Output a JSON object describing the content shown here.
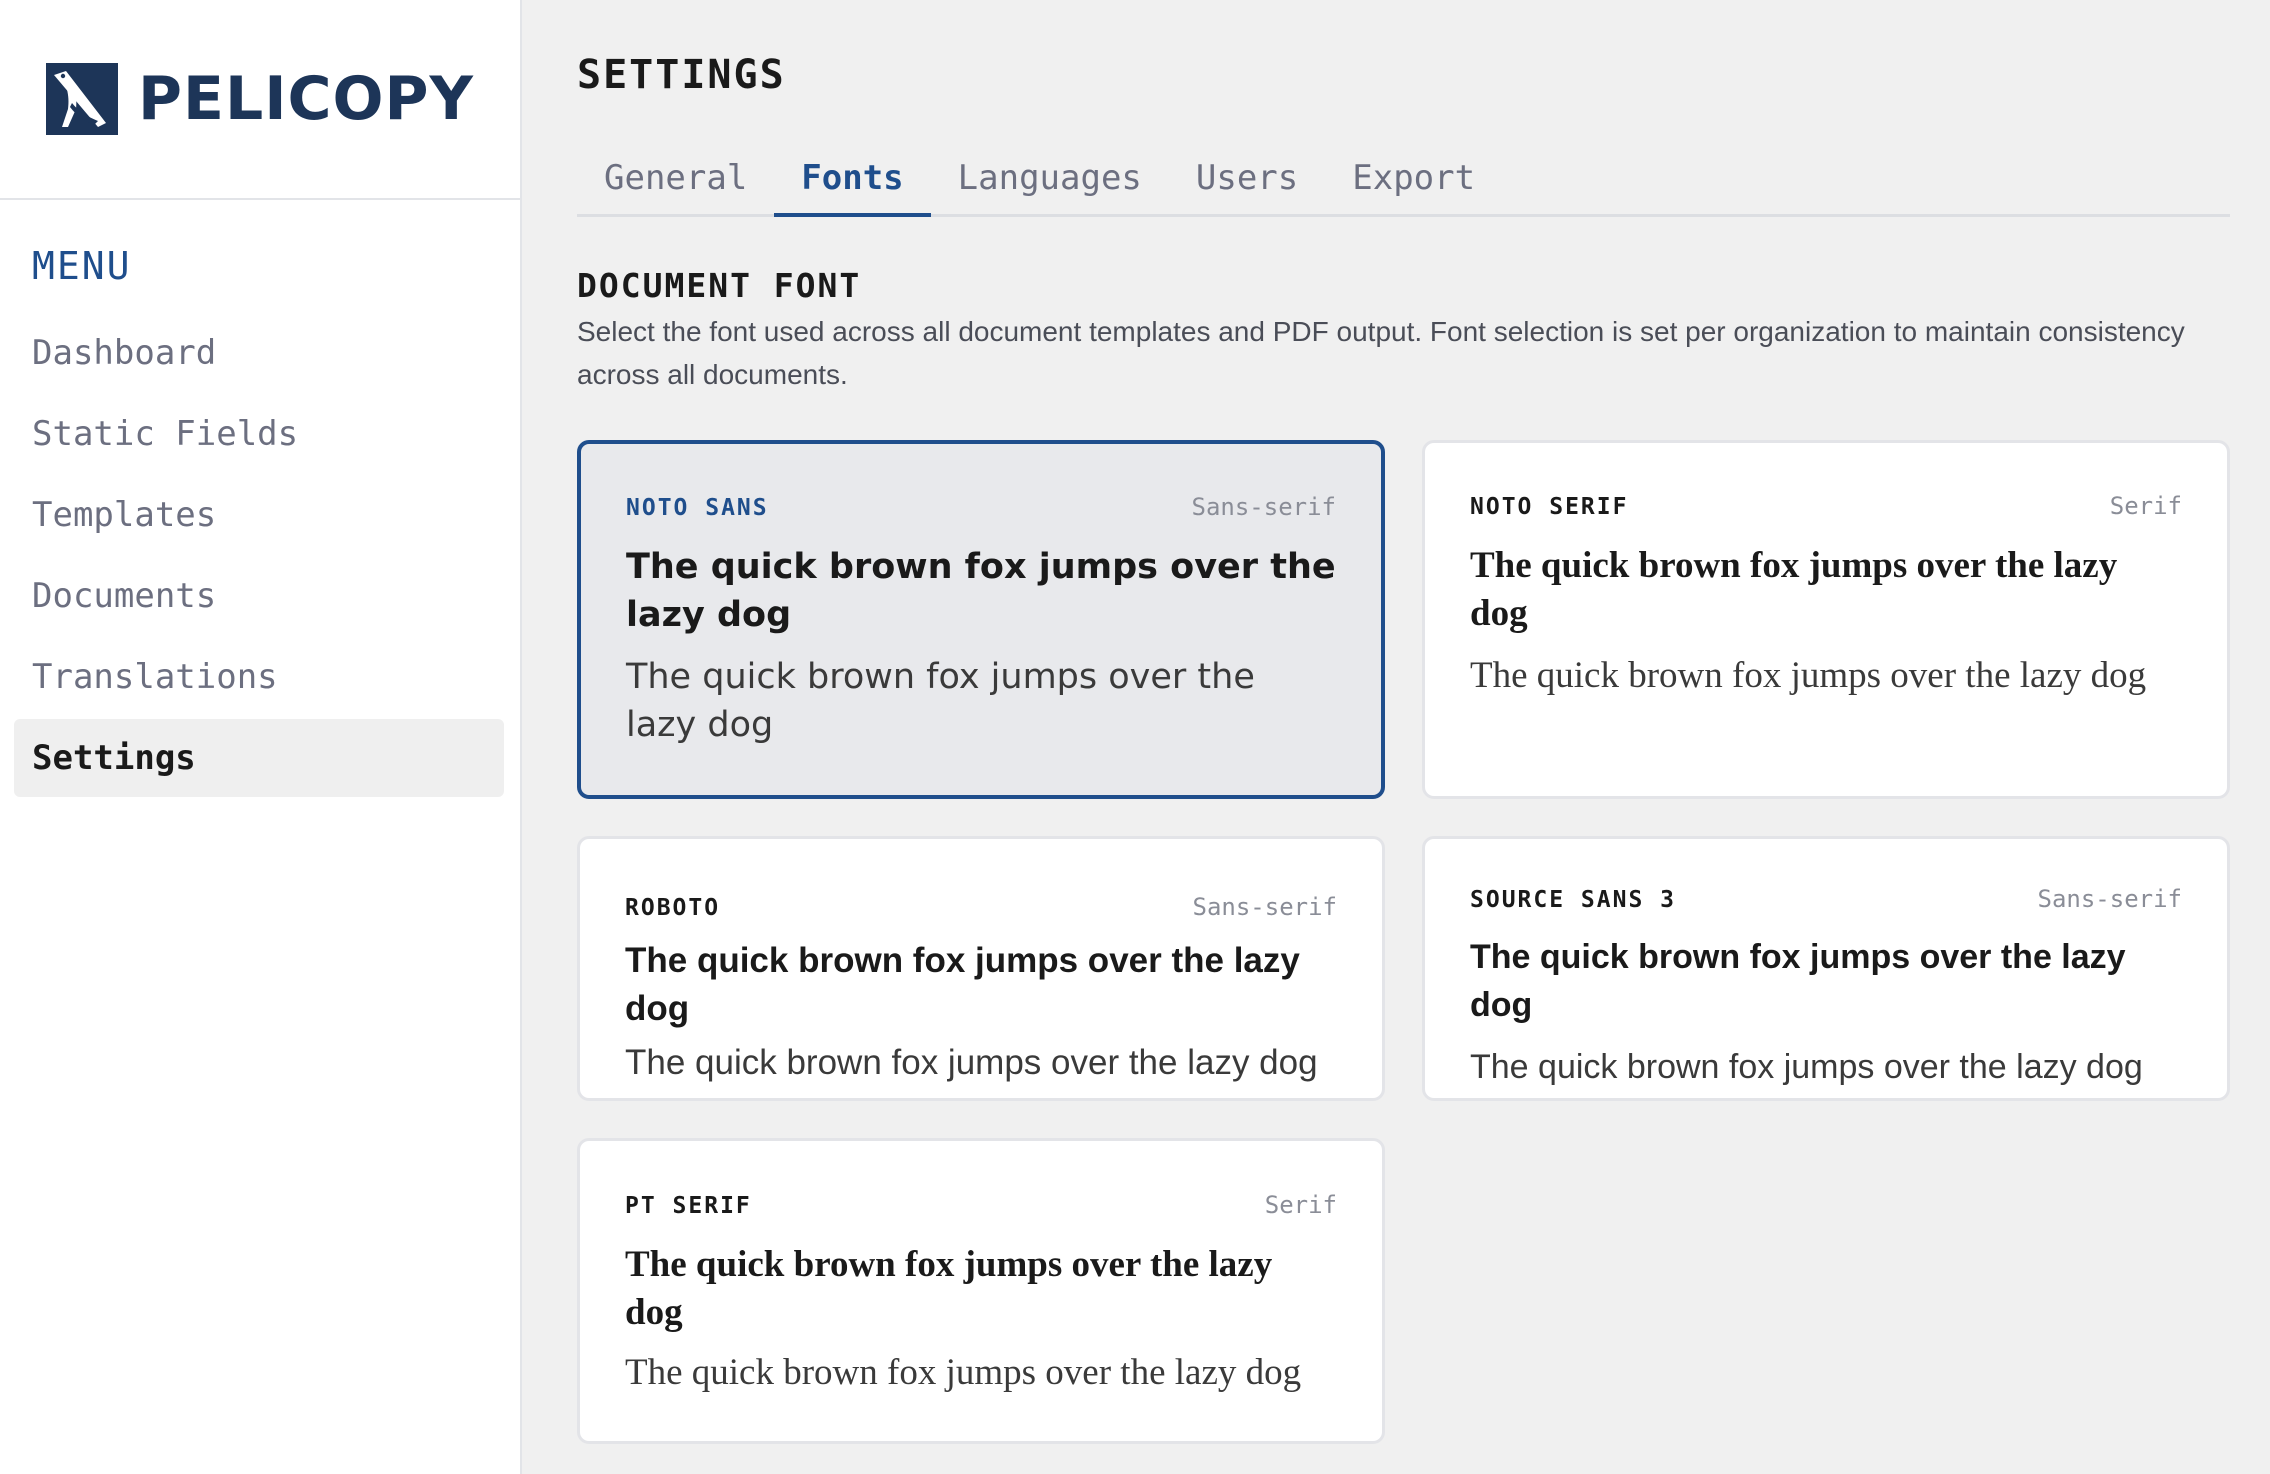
{
  "brand": {
    "name": "PELICOPY",
    "logo_icon": "pelican-logo-icon"
  },
  "sidebar": {
    "menu_title": "MENU",
    "items": [
      {
        "label": "Dashboard",
        "active": false
      },
      {
        "label": "Static Fields",
        "active": false
      },
      {
        "label": "Templates",
        "active": false
      },
      {
        "label": "Documents",
        "active": false
      },
      {
        "label": "Translations",
        "active": false
      },
      {
        "label": "Settings",
        "active": true
      }
    ]
  },
  "page": {
    "title": "SETTINGS"
  },
  "tabs": [
    {
      "label": "General",
      "active": false
    },
    {
      "label": "Fonts",
      "active": true
    },
    {
      "label": "Languages",
      "active": false
    },
    {
      "label": "Users",
      "active": false
    },
    {
      "label": "Export",
      "active": false
    }
  ],
  "section": {
    "title": "DOCUMENT FONT",
    "description": "Select the font used across all document templates and PDF output. Font selection is set per organization to maintain consistency across all documents."
  },
  "fonts": [
    {
      "name": "NOTO SANS",
      "category": "Sans-serif",
      "sample_bold": "The quick brown fox jumps over the lazy dog",
      "sample_regular": "The quick brown fox jumps over the lazy dog",
      "selected": true
    },
    {
      "name": "NOTO SERIF",
      "category": "Serif",
      "sample_bold": "The quick brown fox jumps over the lazy dog",
      "sample_regular": "The quick brown fox jumps over the lazy dog",
      "selected": false
    },
    {
      "name": "ROBOTO",
      "category": "Sans-serif",
      "sample_bold": "The quick brown fox jumps over the lazy dog",
      "sample_regular": "The quick brown fox jumps over the lazy dog",
      "selected": false
    },
    {
      "name": "SOURCE SANS 3",
      "category": "Sans-serif",
      "sample_bold": "The quick brown fox jumps over the lazy dog",
      "sample_regular": "The quick brown fox jumps over the lazy dog",
      "selected": false
    },
    {
      "name": "PT SERIF",
      "category": "Serif",
      "sample_bold": "The quick brown fox jumps over the lazy dog",
      "sample_regular": "The quick brown fox jumps over the lazy dog",
      "selected": false
    }
  ],
  "colors": {
    "accent": "#1f4e8c",
    "brand": "#1d3558",
    "muted_text": "#6c6f80",
    "background": "#f0f0f0"
  }
}
